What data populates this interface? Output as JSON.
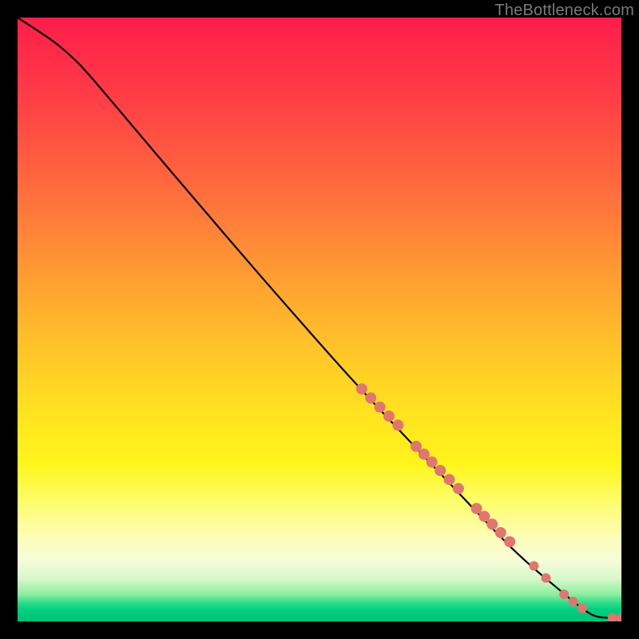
{
  "watermark": "TheBottleneck.com",
  "chart_data": {
    "type": "line",
    "title": "",
    "xlabel": "",
    "ylabel": "",
    "xlim": [
      0,
      100
    ],
    "ylim": [
      0,
      100
    ],
    "grid": false,
    "curve": {
      "name": "bottleneck-curve",
      "color": "#000000",
      "points": [
        {
          "x": 0,
          "y": 100
        },
        {
          "x": 6,
          "y": 96
        },
        {
          "x": 10,
          "y": 92.5
        },
        {
          "x": 14,
          "y": 88
        },
        {
          "x": 25,
          "y": 75
        },
        {
          "x": 40,
          "y": 57.5
        },
        {
          "x": 55,
          "y": 40.5
        },
        {
          "x": 70,
          "y": 24.5
        },
        {
          "x": 82,
          "y": 12
        },
        {
          "x": 90,
          "y": 5
        },
        {
          "x": 94,
          "y": 1.8
        },
        {
          "x": 96,
          "y": 0.8
        },
        {
          "x": 98,
          "y": 0.6
        },
        {
          "x": 100,
          "y": 0.6
        }
      ]
    },
    "markers": {
      "name": "highlighted-points",
      "color": "#e0766f",
      "points": [
        {
          "x": 57,
          "y": 38.5,
          "r": 7
        },
        {
          "x": 58.5,
          "y": 37,
          "r": 7
        },
        {
          "x": 60,
          "y": 35.5,
          "r": 7
        },
        {
          "x": 61.5,
          "y": 34,
          "r": 7
        },
        {
          "x": 63,
          "y": 32.5,
          "r": 7
        },
        {
          "x": 66,
          "y": 29,
          "r": 7
        },
        {
          "x": 67.3,
          "y": 27.7,
          "r": 7
        },
        {
          "x": 68.6,
          "y": 26.4,
          "r": 7
        },
        {
          "x": 70,
          "y": 25,
          "r": 7
        },
        {
          "x": 71.5,
          "y": 23.5,
          "r": 7
        },
        {
          "x": 73,
          "y": 22,
          "r": 7
        },
        {
          "x": 76,
          "y": 18.7,
          "r": 7
        },
        {
          "x": 77.3,
          "y": 17.4,
          "r": 7
        },
        {
          "x": 78.6,
          "y": 16.1,
          "r": 7
        },
        {
          "x": 80,
          "y": 14.7,
          "r": 7
        },
        {
          "x": 81.5,
          "y": 13.2,
          "r": 7
        },
        {
          "x": 85.5,
          "y": 9.2,
          "r": 6
        },
        {
          "x": 87.5,
          "y": 7.2,
          "r": 6
        },
        {
          "x": 90.5,
          "y": 4.5,
          "r": 6
        },
        {
          "x": 92,
          "y": 3.3,
          "r": 6
        },
        {
          "x": 93.5,
          "y": 2.2,
          "r": 6
        },
        {
          "x": 98.5,
          "y": 0.6,
          "r": 6
        },
        {
          "x": 100,
          "y": 0.6,
          "r": 6
        }
      ]
    }
  }
}
